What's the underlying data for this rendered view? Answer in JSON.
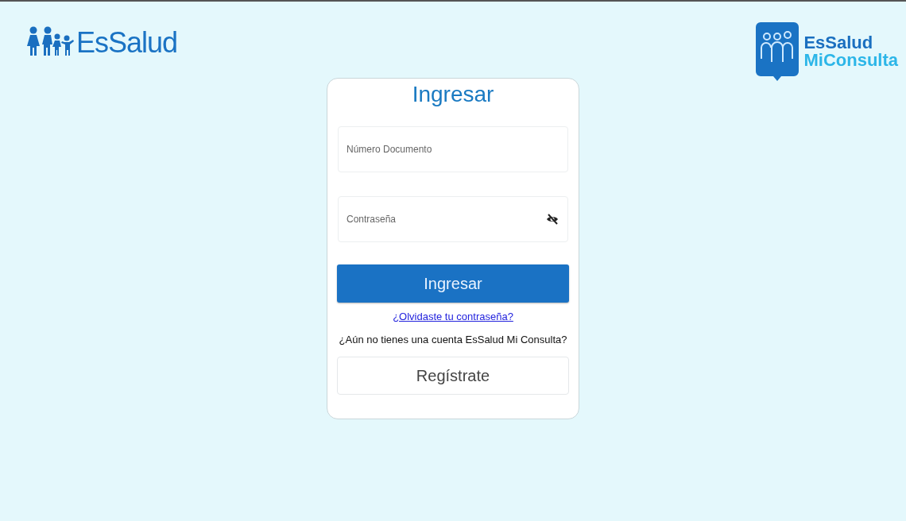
{
  "header": {
    "left_logo": {
      "text": "EsSalud"
    },
    "right_logo": {
      "line_1": "EsSalud",
      "line_2": "MiConsulta"
    }
  },
  "login_card": {
    "title": "Ingresar",
    "fields": [
      {
        "kind": "text",
        "placeholder": "Número Documento"
      },
      {
        "kind": "password",
        "placeholder": "Contraseña"
      }
    ],
    "submit_button": "Ingresar",
    "forgot_link": "¿Olvidaste tu contraseña?",
    "signup_prompt": "¿Aún no tienes una cuenta EsSalud Mi Consulta?",
    "register_button": "Regístrate"
  }
}
